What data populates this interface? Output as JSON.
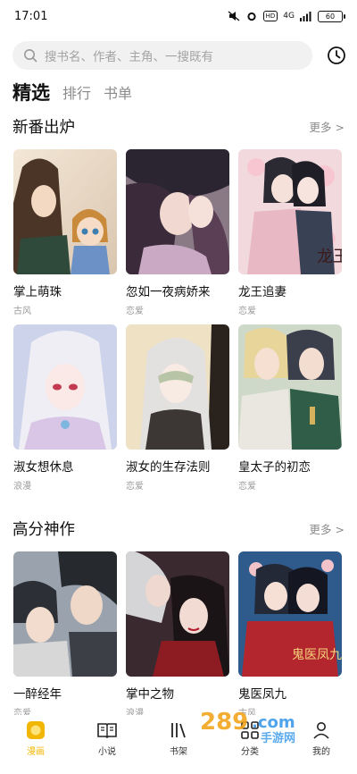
{
  "status": {
    "time": "17:01",
    "network": "4G",
    "battery": "60",
    "hd_label": "HD"
  },
  "search": {
    "placeholder": "搜书名、作者、主角、一搜既有"
  },
  "tabs": [
    {
      "label": "精选",
      "active": true
    },
    {
      "label": "排行",
      "active": false
    },
    {
      "label": "书单",
      "active": false
    }
  ],
  "sections": [
    {
      "title": "新番出炉",
      "more": "更多 >",
      "items": [
        {
          "title": "掌上萌珠",
          "tag": "古风"
        },
        {
          "title": "忽如一夜病娇来",
          "tag": "恋爱"
        },
        {
          "title": "龙王追妻",
          "tag": "恋爱"
        },
        {
          "title": "淑女想休息",
          "tag": "浪漫"
        },
        {
          "title": "淑女的生存法则",
          "tag": "恋爱"
        },
        {
          "title": "皇太子的初恋",
          "tag": "恋爱"
        }
      ]
    },
    {
      "title": "高分神作",
      "more": "更多 >",
      "items": [
        {
          "title": "一醉经年",
          "tag": "恋爱"
        },
        {
          "title": "掌中之物",
          "tag": "浪漫"
        },
        {
          "title": "鬼医凤九",
          "tag": "古风"
        }
      ]
    }
  ],
  "nav": [
    {
      "label": "漫画",
      "icon": "comic-icon",
      "active": true
    },
    {
      "label": "小说",
      "icon": "book-open-icon",
      "active": false
    },
    {
      "label": "书架",
      "icon": "bookshelf-icon",
      "active": false
    },
    {
      "label": "分类",
      "icon": "category-icon",
      "active": false
    },
    {
      "label": "我的",
      "icon": "profile-icon",
      "active": false
    }
  ],
  "watermark": {
    "text": "289.com 手游网",
    "cover_text_1": "龙王",
    "cover_text_2": "鬼医凤九"
  },
  "colors": {
    "accent": "#f2b705",
    "muted": "#8a8a8a"
  }
}
